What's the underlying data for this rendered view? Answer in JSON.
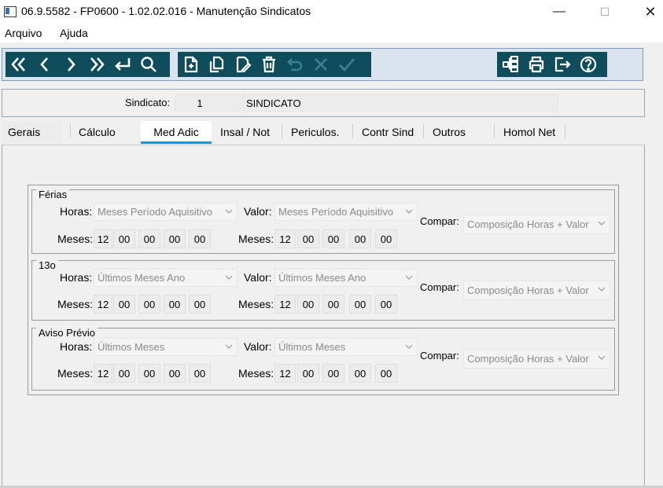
{
  "window": {
    "title": "06.9.5582 - FP0600 - 1.02.02.016 - Manutenção Sindicatos",
    "minimize": "—",
    "maximize": "☐",
    "close": "✕"
  },
  "menu": [
    "Arquivo",
    "Ajuda"
  ],
  "toolbar": {
    "nav_icons": [
      "first-record-icon",
      "prev-record-icon",
      "next-record-icon",
      "last-record-icon",
      "return-icon",
      "search-icon"
    ],
    "edit_icons": [
      "new-record-icon",
      "copy-record-icon",
      "edit-record-icon",
      "delete-icon",
      "undo-icon",
      "cancel-icon",
      "confirm-icon"
    ],
    "tool_icons": [
      "structure-icon",
      "print-icon",
      "exit-icon",
      "help-icon"
    ]
  },
  "sindicato": {
    "label": "Sindicato:",
    "code": "1",
    "name": "SINDICATO"
  },
  "tabs": [
    {
      "label": "Gerais"
    },
    {
      "label": "Cálculo"
    },
    {
      "label": "Med Adic",
      "active": true
    },
    {
      "label": "Insal / Not"
    },
    {
      "label": "Periculos."
    },
    {
      "label": "Contr Sind"
    },
    {
      "label": "Outros"
    },
    {
      "label": "Homol Net"
    }
  ],
  "groups": [
    {
      "title": "Férias",
      "horas_label": "Horas:",
      "horas_value": "Meses Período Aquisitivo",
      "valor_label": "Valor:",
      "valor_value": "Meses Período Aquisitivo",
      "compar_label": "Compar:",
      "compar_value": "Composição Horas + Valor",
      "meses_label": "Meses:",
      "meses_horas": [
        "12",
        "00",
        "00",
        "00",
        "00"
      ],
      "meses_valor": [
        "12",
        "00",
        "00",
        "00",
        "00"
      ]
    },
    {
      "title": "13o",
      "horas_label": "Horas:",
      "horas_value": "Últimos Meses Ano",
      "valor_label": "Valor:",
      "valor_value": "Últimos Meses Ano",
      "compar_label": "Compar:",
      "compar_value": "Composição Horas + Valor",
      "meses_label": "Meses:",
      "meses_horas": [
        "12",
        "00",
        "00",
        "00",
        "00"
      ],
      "meses_valor": [
        "12",
        "00",
        "00",
        "00",
        "00"
      ]
    },
    {
      "title": "Aviso Prévio",
      "horas_label": "Horas:",
      "horas_value": "Últimos Meses",
      "valor_label": "Valor:",
      "valor_value": "Últimos Meses",
      "compar_label": "Compar:",
      "compar_value": "Composição Horas + Valor",
      "meses_label": "Meses:",
      "meses_horas": [
        "12",
        "00",
        "00",
        "00",
        "00"
      ],
      "meses_valor": [
        "12",
        "00",
        "00",
        "00",
        "00"
      ]
    }
  ],
  "colors": {
    "toolbar_bg": "#0f4c5c",
    "tab_active": "#1e90d6"
  }
}
